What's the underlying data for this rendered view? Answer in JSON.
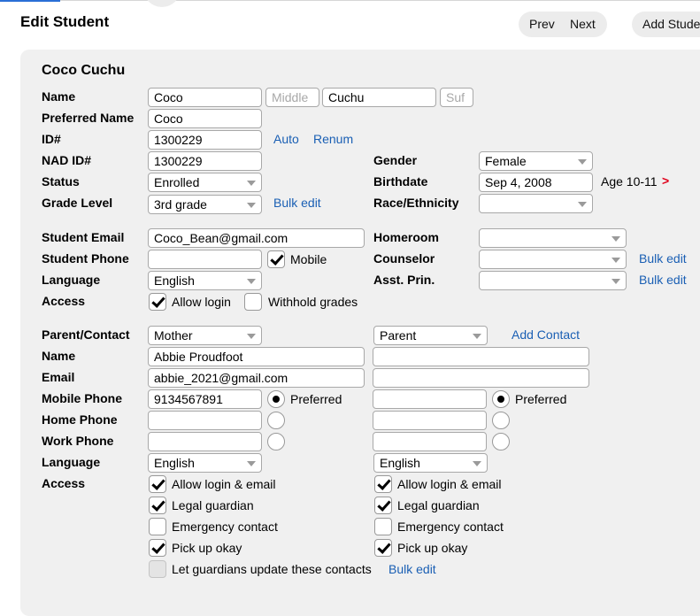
{
  "page": {
    "title": "Edit Student",
    "prev_label": "Prev",
    "next_label": "Next",
    "add_student_label": "Add Student"
  },
  "student": {
    "full_name": "Coco Cuchu",
    "labels": {
      "name": "Name",
      "preferred_name": "Preferred Name",
      "id": "ID#",
      "nad_id": "NAD ID#",
      "status": "Status",
      "grade_level": "Grade Level",
      "gender": "Gender",
      "birthdate": "Birthdate",
      "race": "Race/Ethnicity",
      "email": "Student Email",
      "phone": "Student Phone",
      "language": "Language",
      "access": "Access",
      "homeroom": "Homeroom",
      "counselor": "Counselor",
      "asst_prin": "Asst. Prin."
    },
    "first_name": "Coco",
    "middle_placeholder": "Middle",
    "last_name": "Cuchu",
    "suffix_placeholder": "Suf",
    "preferred_name": "Coco",
    "id": "1300229",
    "auto_link": "Auto",
    "renum_link": "Renum",
    "nad_id": "1300229",
    "status": "Enrolled",
    "grade_level": "3rd grade",
    "bulk_edit": "Bulk edit",
    "gender": "Female",
    "birthdate": "Sep 4, 2008",
    "age": "Age 10-11",
    "age_arrow": ">",
    "race": "",
    "email": "Coco_Bean@gmail.com",
    "phone": "",
    "mobile_label": "Mobile",
    "language": "English",
    "allow_login_label": "Allow login",
    "withhold_grades_label": "Withhold grades",
    "homeroom": "",
    "counselor": "",
    "asst_prin": ""
  },
  "contacts": {
    "labels": {
      "parent_contact": "Parent/Contact",
      "name": "Name",
      "email": "Email",
      "mobile": "Mobile Phone",
      "home": "Home Phone",
      "work": "Work Phone",
      "language": "Language",
      "access": "Access"
    },
    "add_contact_link": "Add Contact",
    "preferred_label": "Preferred",
    "allow_login_email_label": "Allow login & email",
    "legal_guardian_label": "Legal guardian",
    "emergency_contact_label": "Emergency contact",
    "pick_up_label": "Pick up okay",
    "let_guardians_label": "Let guardians update these contacts",
    "bulk_edit": "Bulk edit",
    "primary": {
      "relation": "Mother",
      "name": "Abbie Proudfoot",
      "email": "abbie_2021@gmail.com",
      "mobile": "9134567891",
      "home": "",
      "work": "",
      "language": "English"
    },
    "secondary": {
      "relation": "Parent",
      "name": "",
      "email": "",
      "mobile": "",
      "home": "",
      "work": "",
      "language": "English"
    }
  }
}
